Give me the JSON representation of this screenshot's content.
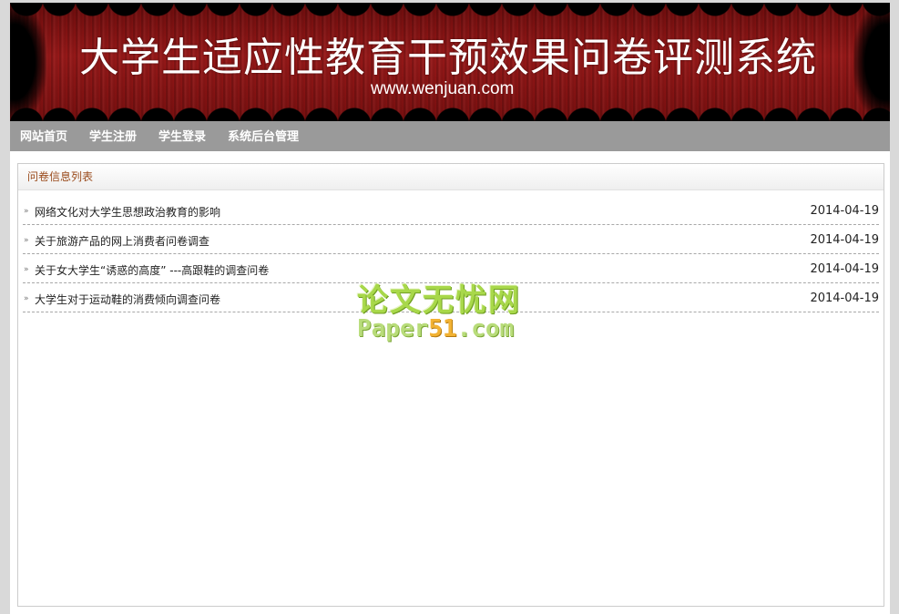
{
  "header": {
    "title": "大学生适应性教育干预效果问卷评测系统",
    "url": "www.wenjuan.com"
  },
  "nav": {
    "items": [
      {
        "label": "网站首页"
      },
      {
        "label": "学生注册"
      },
      {
        "label": "学生登录"
      },
      {
        "label": "系统后台管理"
      }
    ]
  },
  "panel": {
    "title": "问卷信息列表",
    "items": [
      {
        "title": "网络文化对大学生思想政治教育的影响",
        "date": "2014-04-19"
      },
      {
        "title": "关于旅游产品的网上消费者问卷调查",
        "date": "2014-04-19"
      },
      {
        "title": "关于女大学生“诱惑的高度” ---高跟鞋的调查问卷",
        "date": "2014-04-19"
      },
      {
        "title": "大学生对于运动鞋的消费倾向调查问卷",
        "date": "2014-04-19"
      }
    ]
  },
  "watermark": {
    "cn": "论文无忧网",
    "en_prefix": "Paper",
    "en_highlight": "51",
    "en_suffix": ".com"
  },
  "colors": {
    "banner_red": "#8c1515",
    "nav_gray": "#9a9a9a",
    "panel_title": "#9a4b1c"
  },
  "icons": {
    "list_bullet": "double-chevron-right-icon"
  }
}
